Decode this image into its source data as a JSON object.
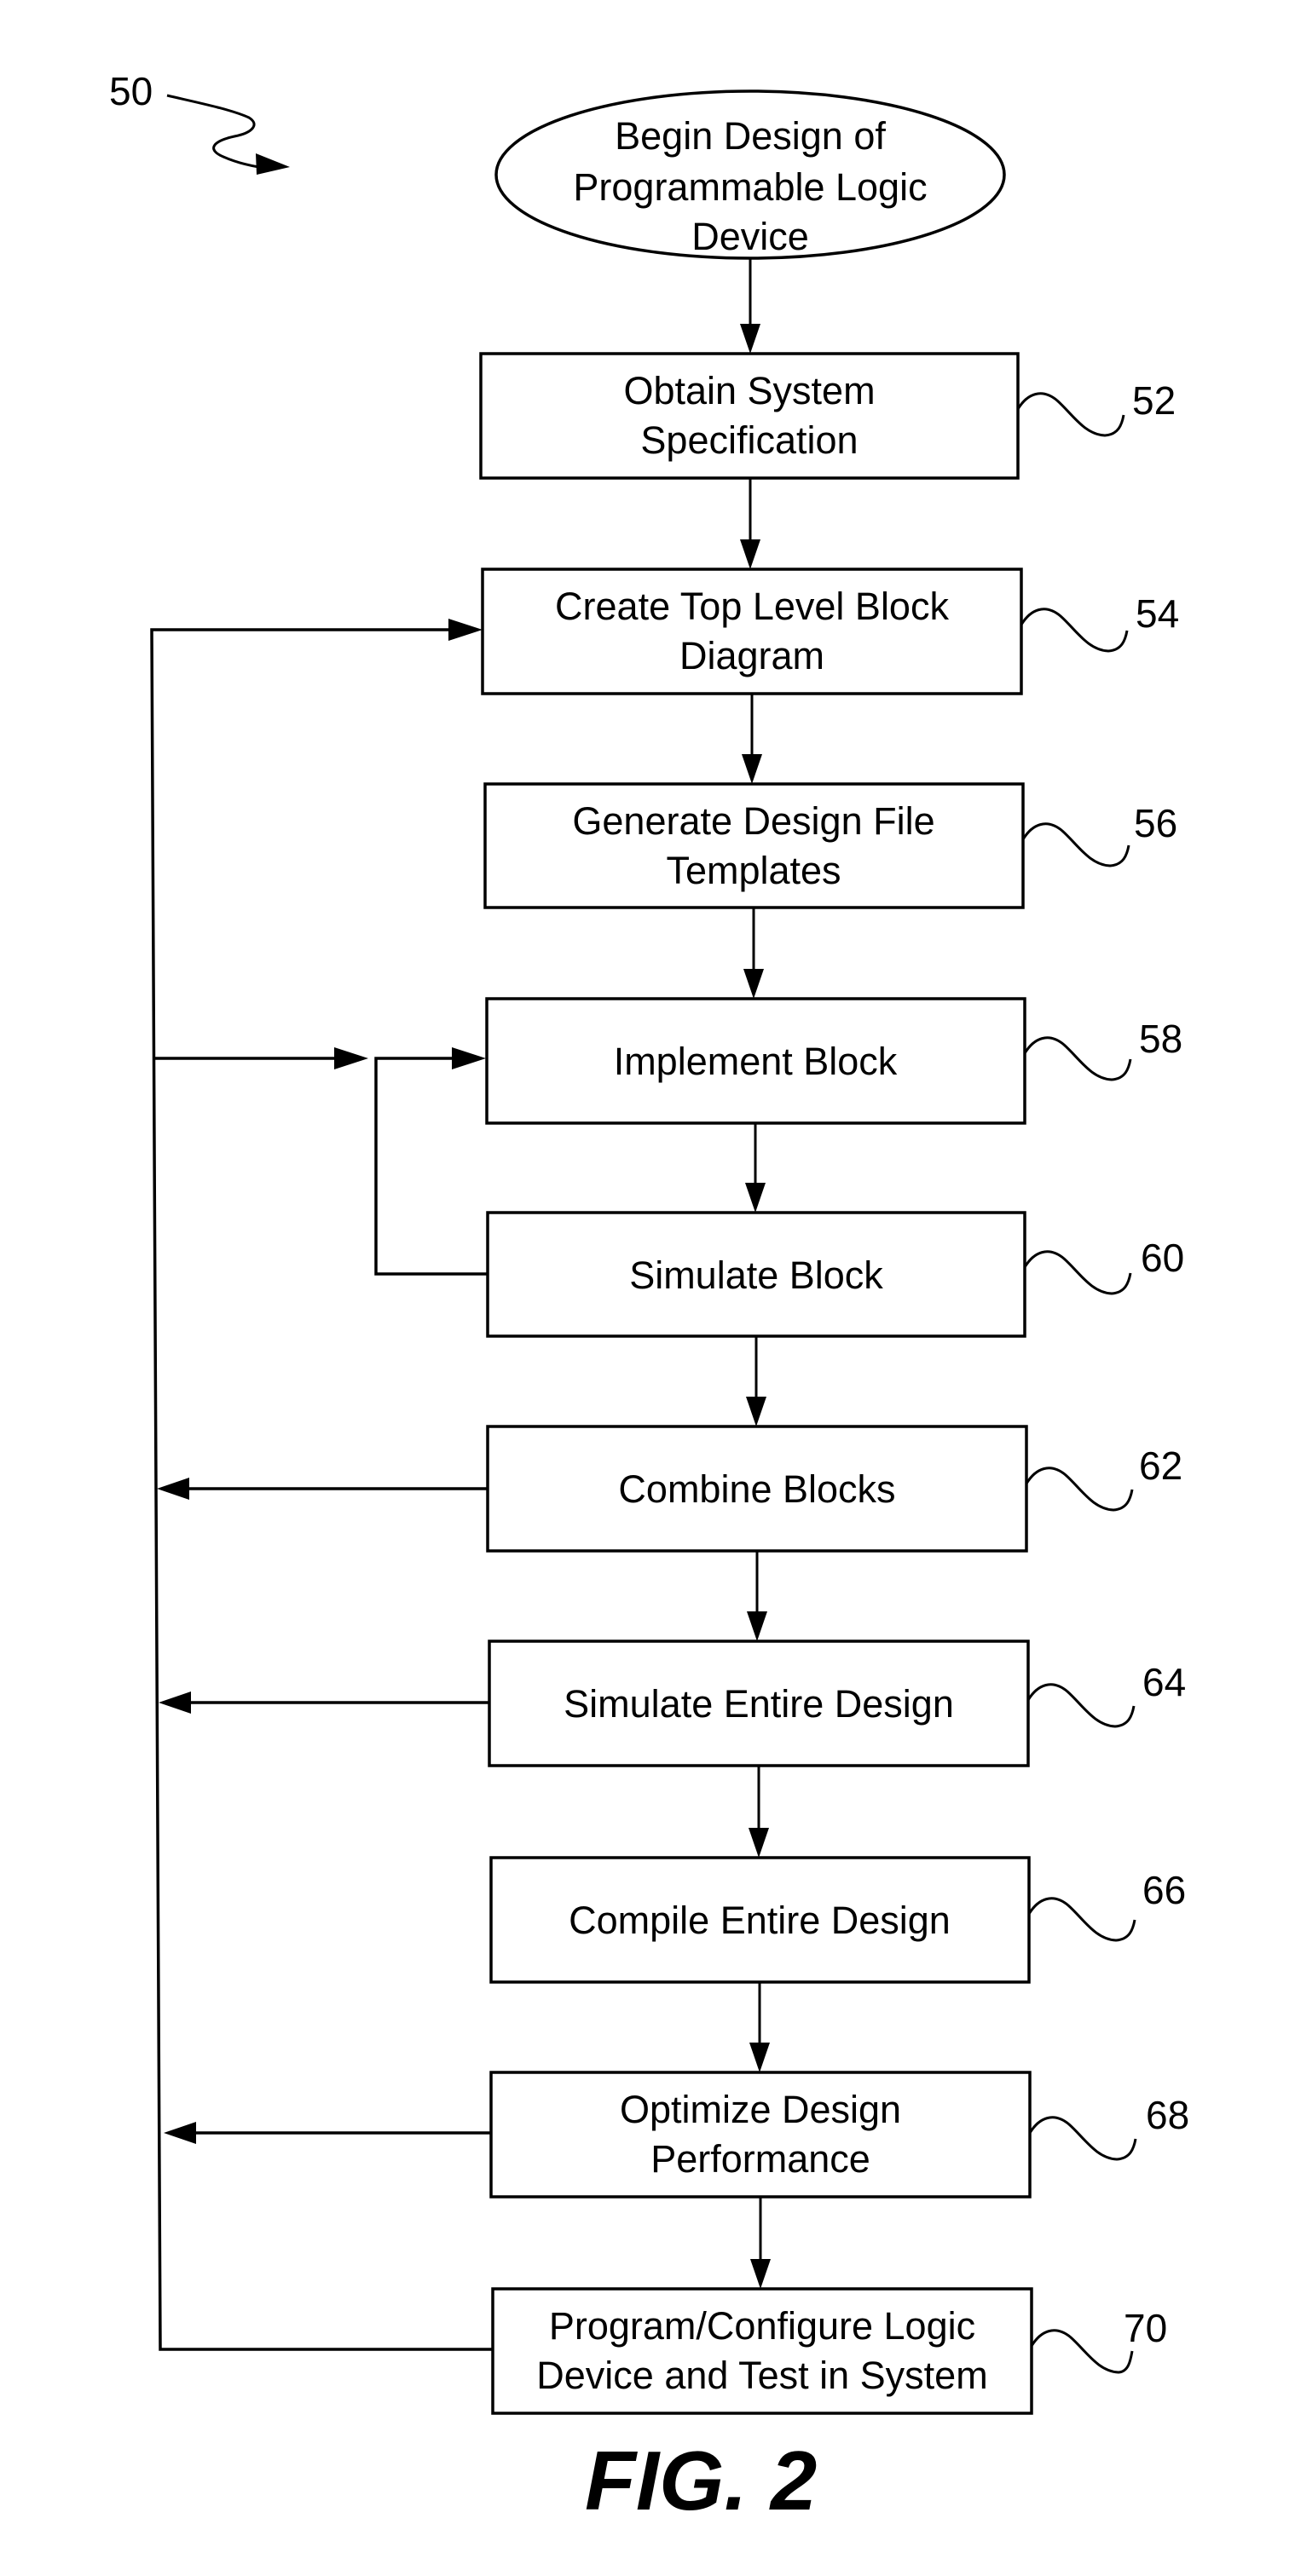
{
  "figure": {
    "label": "FIG. 2",
    "reference": "50"
  },
  "start": {
    "lines": [
      "Begin Design of",
      "Programmable Logic",
      "Device"
    ]
  },
  "steps": [
    {
      "ref": "52",
      "lines": [
        "Obtain System",
        "Specification"
      ]
    },
    {
      "ref": "54",
      "lines": [
        "Create Top Level Block",
        "Diagram"
      ]
    },
    {
      "ref": "56",
      "lines": [
        "Generate Design File",
        "Templates"
      ]
    },
    {
      "ref": "58",
      "lines": [
        "Implement Block"
      ]
    },
    {
      "ref": "60",
      "lines": [
        "Simulate Block"
      ]
    },
    {
      "ref": "62",
      "lines": [
        "Combine Blocks"
      ]
    },
    {
      "ref": "64",
      "lines": [
        "Simulate Entire Design"
      ]
    },
    {
      "ref": "66",
      "lines": [
        "Compile Entire Design"
      ]
    },
    {
      "ref": "68",
      "lines": [
        "Optimize Design",
        "Performance"
      ]
    },
    {
      "ref": "70",
      "lines": [
        "Program/Configure Logic",
        "Device and Test in System"
      ]
    }
  ],
  "edges": [
    {
      "from": "start",
      "to": "52",
      "type": "next"
    },
    {
      "from": "52",
      "to": "54",
      "type": "next"
    },
    {
      "from": "54",
      "to": "56",
      "type": "next"
    },
    {
      "from": "56",
      "to": "58",
      "type": "next"
    },
    {
      "from": "58",
      "to": "60",
      "type": "next"
    },
    {
      "from": "60",
      "to": "62",
      "type": "next"
    },
    {
      "from": "62",
      "to": "64",
      "type": "next"
    },
    {
      "from": "64",
      "to": "66",
      "type": "next"
    },
    {
      "from": "66",
      "to": "68",
      "type": "next"
    },
    {
      "from": "68",
      "to": "70",
      "type": "next"
    },
    {
      "from": "60",
      "to": "58",
      "type": "loop"
    },
    {
      "from": "62",
      "to": "feedback-bus",
      "type": "feedback"
    },
    {
      "from": "64",
      "to": "feedback-bus",
      "type": "feedback"
    },
    {
      "from": "68",
      "to": "feedback-bus",
      "type": "feedback"
    },
    {
      "from": "70",
      "to": "feedback-bus",
      "type": "feedback"
    },
    {
      "from": "feedback-bus",
      "to": "54",
      "type": "feedback"
    },
    {
      "from": "feedback-bus",
      "to": "58",
      "type": "feedback"
    }
  ]
}
